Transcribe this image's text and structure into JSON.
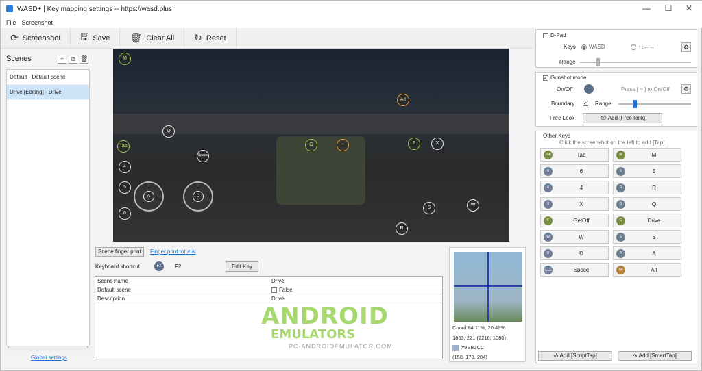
{
  "window": {
    "title": "WASD+ | Key mapping settings -- https://wasd.plus",
    "controls": {
      "minimize": "—",
      "maximize": "☐",
      "close": "✕"
    }
  },
  "menu": [
    "File",
    "Screenshot"
  ],
  "toolbar": {
    "screenshot": "Screenshot",
    "save": "Save",
    "clear_all": "Clear All",
    "reset": "Reset"
  },
  "scenes": {
    "title": "Scenes",
    "items": [
      {
        "label": "Default - Default scene"
      },
      {
        "label": "Drive [Editing] - Drive"
      }
    ],
    "global_settings": "Global settings"
  },
  "screen_keys": [
    {
      "label": "M",
      "style": "green"
    },
    {
      "label": "Q",
      "style": "white"
    },
    {
      "label": "Tab",
      "style": "green"
    },
    {
      "label": "4",
      "style": "white"
    },
    {
      "label": "5",
      "style": "white"
    },
    {
      "label": "6",
      "style": "white"
    },
    {
      "label": "Space",
      "style": "white"
    },
    {
      "label": "G",
      "style": "green"
    },
    {
      "label": "~",
      "style": "orange"
    },
    {
      "label": "F",
      "style": "green"
    },
    {
      "label": "X",
      "style": "white"
    },
    {
      "label": "Alt",
      "style": "orange"
    },
    {
      "label": "S",
      "style": "white"
    },
    {
      "label": "W",
      "style": "white"
    },
    {
      "label": "R",
      "style": "white"
    }
  ],
  "joysticks": [
    {
      "label": "A"
    },
    {
      "label": "D"
    }
  ],
  "scene_props": {
    "finger_print_btn": "Scene finger print",
    "finger_print_link": "Finger print toturial",
    "keyboard_shortcut_label": "Keyboard shortcut",
    "shortcut_key": "F2",
    "shortcut_value": "F2",
    "edit_key": "Edit Key",
    "rows": [
      {
        "key": "Scene name",
        "value": "Drive"
      },
      {
        "key": "Default scene",
        "value": "False"
      },
      {
        "key": "Description",
        "value": "Drive"
      }
    ]
  },
  "watermark": {
    "line1": "ANDROID",
    "line2": "EMULATORS",
    "line3": "PC-ANDROIDEMULATOR.COM"
  },
  "zoom": {
    "coord": "Coord  84.11%, 20.48%",
    "pixel": "1863, 221 (2216, 1080)",
    "color_hex": "#9EB2CC",
    "color_rgb": "(158, 178, 204)"
  },
  "dpad": {
    "title": "D-Pad",
    "keys_label": "Keys",
    "opt_wasd": "WASD",
    "opt_arrows": "↑↓←→",
    "range_label": "Range"
  },
  "gunshot": {
    "title": "Gunshot mode",
    "onoff_label": "On/Off",
    "hint": "Press [ ~ ] to On/Off",
    "boundary_label": "Boundary",
    "range_label": "Range",
    "freelook_label": "Free Look",
    "freelook_btn": "Add [Free look]"
  },
  "other_keys": {
    "title": "Other Keys",
    "hint": "Click the screenshot on the left to add [Tap]",
    "items": [
      {
        "dot": "Tab",
        "label": "Tab",
        "style": "g"
      },
      {
        "dot": "M",
        "label": "M",
        "style": "g"
      },
      {
        "dot": "6",
        "label": "6",
        "style": "b"
      },
      {
        "dot": "5",
        "label": "5",
        "style": "b"
      },
      {
        "dot": "4",
        "label": "4",
        "style": "b"
      },
      {
        "dot": "R",
        "label": "R",
        "style": "b"
      },
      {
        "dot": "X",
        "label": "X",
        "style": "b"
      },
      {
        "dot": "Q",
        "label": "Q",
        "style": "b"
      },
      {
        "dot": "F",
        "label": "GetOff",
        "style": "g"
      },
      {
        "dot": "G",
        "label": "Drive",
        "style": "g"
      },
      {
        "dot": "W",
        "label": "W",
        "style": "b"
      },
      {
        "dot": "S",
        "label": "S",
        "style": "b"
      },
      {
        "dot": "D",
        "label": "D",
        "style": "b"
      },
      {
        "dot": "A",
        "label": "A",
        "style": "b"
      },
      {
        "dot": "Space",
        "label": "Space",
        "style": "b"
      },
      {
        "dot": "Alt",
        "label": "Alt",
        "style": "o"
      }
    ],
    "add_script": "Add [ScriptTap]",
    "add_smart": "Add [SmartTap]"
  },
  "colors": {
    "accent": "#1a6fd1",
    "selection": "#cde3f7",
    "watermark_green": "#a6d86e",
    "crosshair": "#2a3fb2"
  }
}
